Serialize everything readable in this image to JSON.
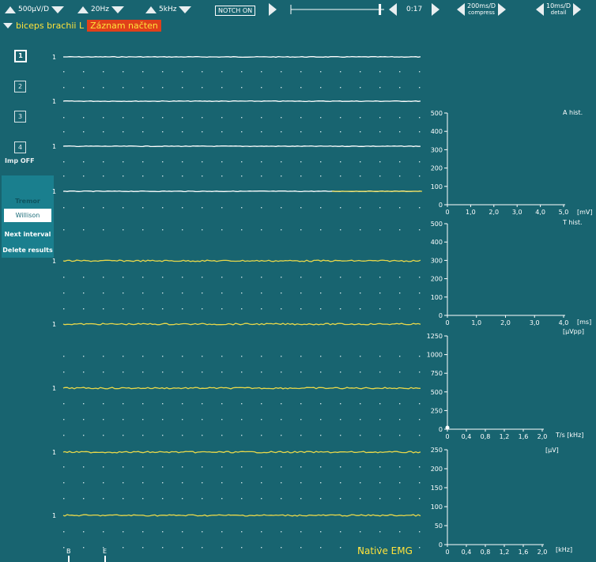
{
  "toolbar": {
    "sensitivity": "500µV/D",
    "low_filter": "20Hz",
    "high_filter": "5kHz",
    "notch": "NOTCH ON",
    "time": "0:17",
    "compress_value": "200ms/D",
    "compress_label": "compress",
    "detail_value": "10ms/D",
    "detail_label": "detail",
    "position_fraction": 0.95
  },
  "header": {
    "muscle": "biceps brachii L",
    "status": "Záznam načten"
  },
  "channels": [
    "1",
    "2",
    "3",
    "4"
  ],
  "imp": "Imp OFF",
  "panel": {
    "tremor": "Tremor",
    "willison": "Willison",
    "next": "Next interval",
    "delete": "Delete results"
  },
  "trace_label": "1",
  "footer": {
    "mode": "Native EMG",
    "marker_b": "B",
    "marker_e": "E"
  },
  "histograms": [
    {
      "title": "A hist.",
      "xunit": "[mV]",
      "yticks": [
        "0",
        "100",
        "200",
        "300",
        "400",
        "500"
      ],
      "xticks": [
        "0",
        "1,0",
        "2,0",
        "3,0",
        "4,0",
        "5,0"
      ]
    },
    {
      "title": "T hist.",
      "xunit": "[ms]",
      "sub": "[µVpp]",
      "yticks": [
        "0",
        "100",
        "200",
        "300",
        "400",
        "500"
      ],
      "xticks": [
        "0",
        "1,0",
        "2,0",
        "3,0",
        "4,0"
      ]
    },
    {
      "title": "",
      "xunit": "T/s [kHz]",
      "sub": "[µV]",
      "yticks": [
        "0",
        "250",
        "500",
        "750",
        "1000",
        "1250"
      ],
      "xticks": [
        "0",
        "0,4",
        "0,8",
        "1,2",
        "1,6",
        "2,0"
      ]
    },
    {
      "title": "",
      "xunit": "[kHz]",
      "yticks": [
        "0",
        "50",
        "100",
        "150",
        "200",
        "250"
      ],
      "xticks": [
        "0",
        "0,4",
        "0,8",
        "1,2",
        "1,6",
        "2,0"
      ]
    }
  ],
  "colors": {
    "background": "#186470",
    "trace_white": "#ffffff",
    "trace_yellow": "#e8d84a",
    "accent": "#e0401a"
  }
}
